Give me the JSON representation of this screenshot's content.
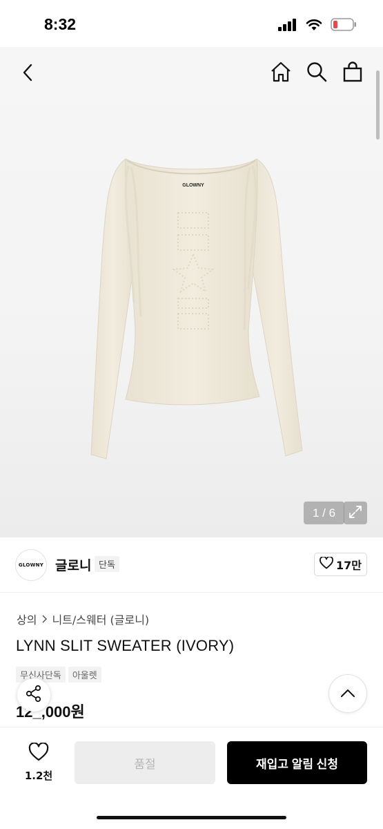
{
  "status_bar": {
    "time": "8:32",
    "icons": [
      "cellular-signal-icon",
      "wifi-icon",
      "battery-low-icon"
    ],
    "battery_color": "#e5484d"
  },
  "nav": {
    "icons": [
      "back-chevron-icon",
      "home-icon",
      "search-icon",
      "shopping-bag-icon"
    ]
  },
  "hero": {
    "image_brand_label": "GLOWNY",
    "pager": "1 / 6",
    "sweater_color": "#efe9db"
  },
  "brand": {
    "logo_text": "GLOWNY",
    "name": "글로니",
    "badge": "단독",
    "likes": "17만"
  },
  "product": {
    "breadcrumb": [
      "상의",
      "니트/스웨터 (글로니)"
    ],
    "title": "LYNN SLIT SWEATER (IVORY)",
    "tags": [
      "무신사단독",
      "아울렛"
    ],
    "price": "12_,000원"
  },
  "bottom_bar": {
    "wish_count": "1.2천",
    "soldout_label": "품절",
    "restock_label": "재입고 알림 신청"
  }
}
